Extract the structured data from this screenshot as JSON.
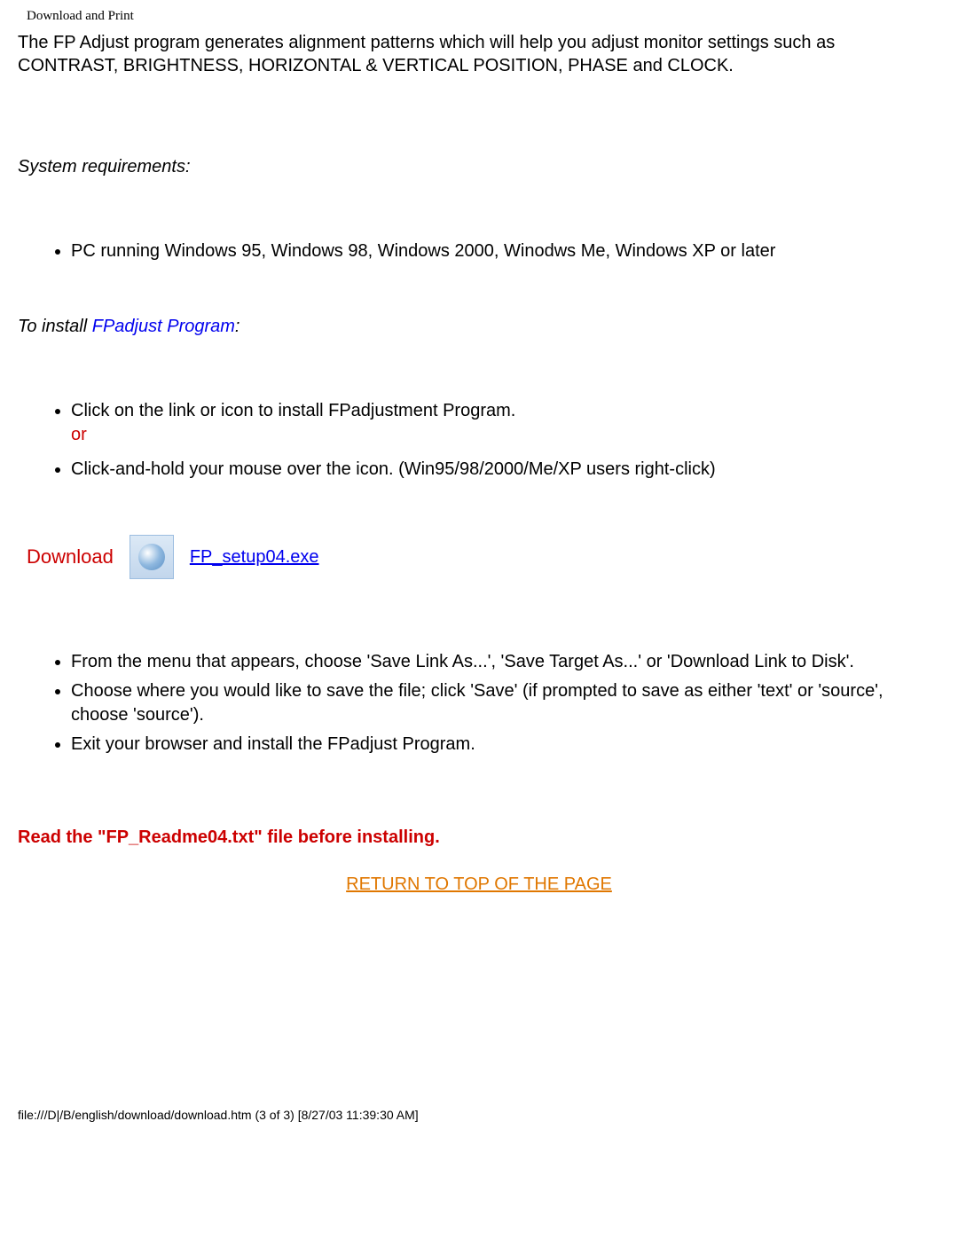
{
  "header": "Download and Print",
  "intro": "The FP Adjust program generates alignment patterns which will help you adjust monitor settings such as CONTRAST, BRIGHTNESS, HORIZONTAL & VERTICAL POSITION, PHASE and CLOCK.",
  "sys_req_heading": "System requirements:",
  "sys_req_item": "PC running Windows 95, Windows 98, Windows 2000, Winodws Me, Windows XP or later",
  "install_heading_prefix": "To install ",
  "install_heading_link": "FPadjust Program",
  "install_heading_suffix": ":",
  "install_item1_line1": "Click on the link or icon to install FPadjustment Program.",
  "install_item1_or": "or",
  "install_item2": "Click-and-hold your mouse over the icon. (Win95/98/2000/Me/XP users right-click)",
  "download_label": "Download",
  "download_filename": "FP_setup04.exe",
  "post_item1": "From the menu that appears, choose 'Save Link As...', 'Save Target As...' or 'Download Link to Disk'.",
  "post_item2": "Choose where you would like to save the file; click 'Save' (if prompted to save as either 'text' or 'source', choose 'source').",
  "post_item3": "Exit your browser and install the FPadjust Program.",
  "readme_warn": "Read the \"FP_Readme04.txt\" file before installing.",
  "return_link": "RETURN TO TOP OF THE PAGE",
  "footer_path": "file:///D|/B/english/download/download.htm (3 of 3) [8/27/03 11:39:30 AM]"
}
